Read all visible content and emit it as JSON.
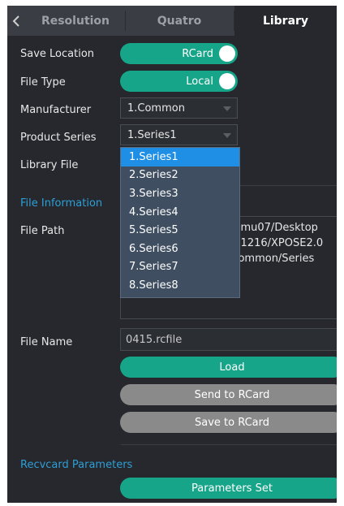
{
  "tabs": {
    "back_icon": "chevron-left-icon",
    "items": [
      "Resolution",
      "Quatro",
      "Library"
    ],
    "active": "Library"
  },
  "save_location": {
    "label": "Save Location",
    "value": "RCard"
  },
  "file_type": {
    "label": "File Type",
    "value": "Local"
  },
  "manufacturer": {
    "label": "Manufacturer",
    "value": "1.Common"
  },
  "product_series": {
    "label": "Product Series",
    "value": "1.Series1",
    "options": [
      "1.Series1",
      "2.Series2",
      "3.Series3",
      "4.Series4",
      "5.Series5",
      "6.Series6",
      "7.Series7",
      "8.Series8"
    ]
  },
  "library_file": {
    "label": "Library File"
  },
  "file_information": {
    "section_title": "File Information",
    "path_label": "File Path",
    "path_lines": [
      "ngmu07/Desktop",
      "211216/XPOSE2.0",
      "/Common/Series"
    ],
    "name_label": "File Name",
    "name_value": "0415.rcfile"
  },
  "buttons": {
    "load": "Load",
    "send": "Send to RCard",
    "save": "Save to RCard",
    "params": "Parameters Set"
  },
  "recvcard": {
    "section_title": "Recvcard Parameters"
  },
  "colors": {
    "accent": "#17a589",
    "section": "#2d9fd6",
    "selected": "#1f8fe6",
    "panel": "#26282d"
  }
}
